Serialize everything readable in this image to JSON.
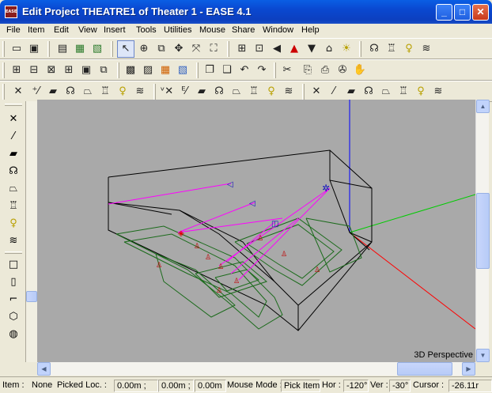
{
  "window": {
    "title": "Edit Project THEATRE1 of Theater 1 - EASE 4.1",
    "app_icon": "EASE",
    "min": "_",
    "max": "□",
    "close": "✕"
  },
  "menu": [
    "File",
    "Item",
    "Edit",
    "View",
    "Insert",
    "Tools",
    "Utilities",
    "Mouse",
    "Share",
    "Window",
    "Help"
  ],
  "toolbar_icons": {
    "row1": [
      "new-icon",
      "save-icon",
      "print-icon",
      "export-icon",
      "import-icon",
      "pointer-icon",
      "target-icon",
      "copy-icon",
      "move-icon",
      "zoom-fit-icon",
      "zoom-box-icon",
      "grid-icon",
      "vertex-icon",
      "left-arrow-icon",
      "hat-icon",
      "down-arrow-icon",
      "home-icon",
      "sun-icon",
      "speaker-array-icon",
      "chair-icon",
      "lamp-icon",
      "wave-icon"
    ],
    "row2": [
      "view-top-icon",
      "view-front-icon",
      "view-side-icon",
      "view-3d-icon",
      "view-zoom-icon",
      "view-copy-icon",
      "render-icon",
      "render2-icon",
      "color-map-icon",
      "edit-icon",
      "book-icon",
      "book2-icon",
      "undo-icon",
      "redo-icon",
      "scissors-icon",
      "tool-a-icon",
      "tool-b-icon",
      "tool-c-icon",
      "tool-d-icon"
    ],
    "row3": [
      "delete-icon",
      "vertex-add-icon",
      "face-icon",
      "speaker-icon",
      "audience-icon",
      "seat-icon",
      "light-icon",
      "wave-icon",
      "vertex-x-icon",
      "edge-add-icon",
      "face2-icon",
      "speaker2-icon",
      "audience2-icon",
      "seat2-icon",
      "light2-icon",
      "wave2-icon",
      "del-group-icon",
      "vertex-group-icon",
      "face-group-icon",
      "speaker-group-icon",
      "audience-group-icon",
      "seat-group-icon",
      "light-group-icon",
      "wave-group-icon"
    ]
  },
  "left_toolbar_icons": [
    "cross-icon",
    "vertex-icon",
    "face-icon",
    "speaker-icon",
    "audience-icon",
    "seat-icon",
    "light-icon",
    "wave-icon",
    "square-icon",
    "rectangle-icon",
    "polyline-icon",
    "polygon-icon",
    "sphere-icon"
  ],
  "viewport": {
    "label": "3D Perspective",
    "background": "#a9a9a9",
    "axis_colors": {
      "x": "#ff0000",
      "y": "#00cc00",
      "z": "#0000ff"
    },
    "speaker_color": "#ff00ff"
  },
  "status": {
    "item_label": "Item :",
    "item_value": "None",
    "picked_label": "Picked Loc. :",
    "picked_x": "0.00m ;",
    "picked_y": "0.00m ;",
    "picked_z": "0.00m",
    "mouse_mode_label": "Mouse Mode :",
    "mouse_mode_value": "Pick Item",
    "hor_label": "Hor :",
    "hor_value": "-120°",
    "ver_label": "Ver :",
    "ver_value": "-30°",
    "cursor_label": "Cursor :",
    "cursor_value": "-26.11r"
  }
}
